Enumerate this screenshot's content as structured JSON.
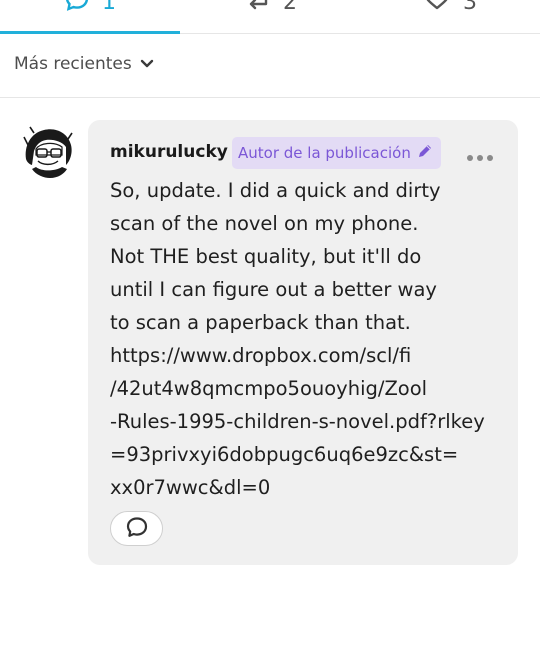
{
  "tabs": [
    {
      "count": "1",
      "icon": "comment-icon",
      "active": true
    },
    {
      "count": "2",
      "icon": "reblog-icon",
      "active": false
    },
    {
      "count": "3",
      "icon": "heart-icon",
      "active": false
    }
  ],
  "sort": {
    "label": "Más recientes",
    "icon": "chevron-down-icon"
  },
  "comment": {
    "username": "mikurulucky",
    "badge": "Autor de la publicación",
    "badge_icon": "pencil-icon",
    "more_icon": "more-options-icon",
    "body_lines": [
      "So, update. I did a quick and dirty",
      "scan of the novel on my phone.",
      "Not THE best quality, but it'll do",
      "until I can figure out a better way",
      "to scan a paperback than that.",
      "https://www.dropbox.com/scl/fi",
      "/42ut4w8qmcmpo5ouoyhig/Zool",
      "-Rules-1995-children-s-novel.pdf?rlkey",
      "=93privxyi6dobpugc6uq6e9zc&st=",
      "xx0r7wwc&dl=0"
    ],
    "reply_icon": "reply-icon"
  },
  "colors": {
    "accent": "#21b0da",
    "badge_bg": "#e3dbf5",
    "badge_text": "#7b57d6",
    "bubble_bg": "#f0f0f0"
  }
}
